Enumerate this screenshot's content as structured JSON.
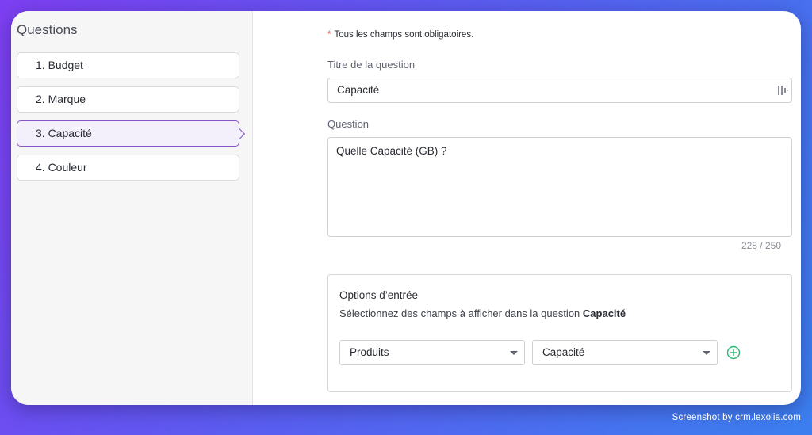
{
  "sidebar": {
    "title": "Questions",
    "items": [
      {
        "label": "1. Budget"
      },
      {
        "label": "2. Marque"
      },
      {
        "label": "3. Capacité"
      },
      {
        "label": "4. Couleur"
      }
    ],
    "active_index": 2
  },
  "form": {
    "required_note": "Tous les champs sont obligatoires.",
    "title_label": "Titre de la question",
    "title_value": "Capacité",
    "question_label": "Question",
    "question_value": "Quelle Capacité (GB) ?",
    "char_count": "228 / 250"
  },
  "options": {
    "title": "Options d’entrée",
    "description_prefix": "Sélectionnez des champs à afficher dans la question ",
    "description_target": "Capacité",
    "select_1_value": "Produits",
    "select_2_value": "Capacité",
    "add_icon": "plus-circle-icon"
  },
  "watermark": "Screenshot by crm.lexolia.com",
  "colors": {
    "accent_purple": "#8a54c9",
    "active_bg": "#f3effb",
    "required_star": "#e23b3b",
    "add_green": "#2bb673"
  }
}
